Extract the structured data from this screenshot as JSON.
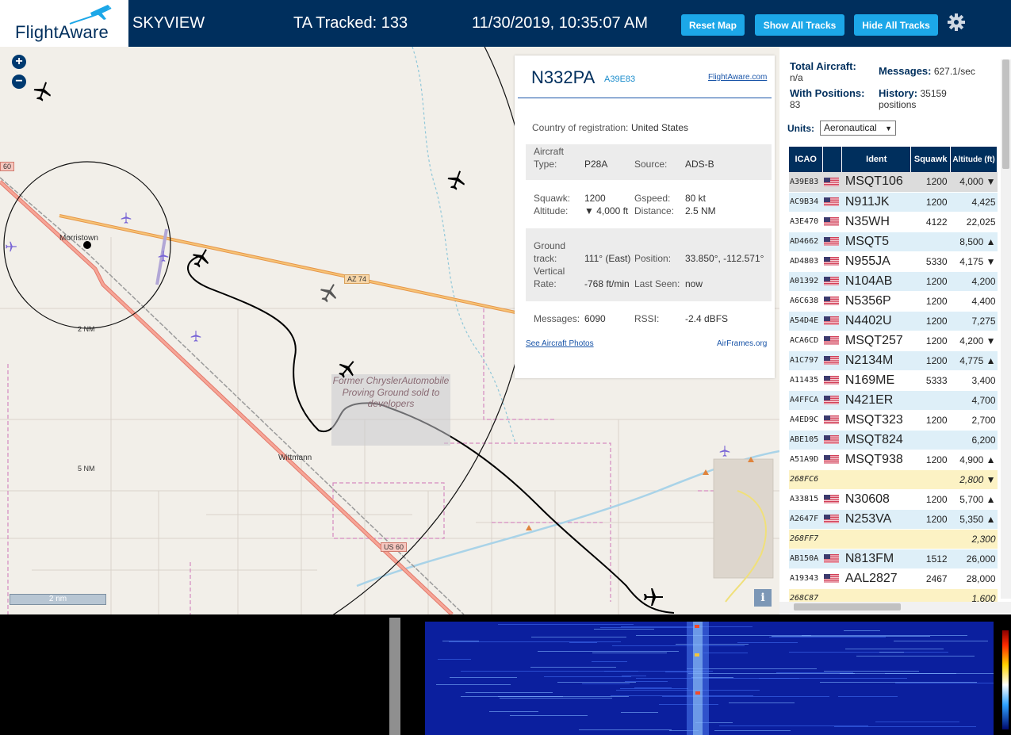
{
  "header": {
    "logo_text": "FlightAware",
    "app_name": "SKYVIEW",
    "tracked": "TA Tracked: 133",
    "datetime": "11/30/2019, 10:35:07 AM",
    "buttons": {
      "reset_map": "Reset Map",
      "show_all": "Show All Tracks",
      "hide_all": "Hide All Tracks"
    },
    "settings_icon": "gear-icon"
  },
  "map": {
    "labels": {
      "town1": "Morristown",
      "town2": "Wittmann",
      "ring1": "2 NM",
      "ring2": "5 NM",
      "road_az74": "AZ 74",
      "road_us60": "US 60",
      "road_60": "60",
      "proving_ground": "Former ChryslerAutomobile Proving Ground sold to developers"
    },
    "scalebar": "2 nm",
    "zoom_in": "+",
    "zoom_out": "−",
    "info_label": "i"
  },
  "popup": {
    "ident": "N332PA",
    "icao": "A39E83",
    "fa_link": "FlightAware.com",
    "country_label": "Country of registration:",
    "country": "United States",
    "aircraft_type_label_1": "Aircraft",
    "aircraft_type_label_2": "Type:",
    "aircraft_type": "P28A",
    "source_label": "Source:",
    "source": "ADS-B",
    "squawk_label": "Squawk:",
    "squawk": "1200",
    "gspeed_label": "Gspeed:",
    "gspeed": "80 kt",
    "altitude_label": "Altitude:",
    "altitude": "▼ 4,000 ft",
    "distance_label": "Distance:",
    "distance": "2.5 NM",
    "track_label_1": "Ground",
    "track_label_2": "track:",
    "track": "111° (East)",
    "position_label": "Position:",
    "position": "33.850°, -112.571°",
    "vrate_label_1": "Vertical",
    "vrate_label_2": "Rate:",
    "vrate": "-768 ft/min",
    "last_seen_label": "Last Seen:",
    "last_seen": "now",
    "messages_label": "Messages:",
    "messages": "6090",
    "rssi_label": "RSSI:",
    "rssi": "-2.4 dBFS",
    "photos_link": "See Aircraft Photos",
    "airframes_link": "AirFrames.org"
  },
  "sidebar": {
    "total_label": "Total Aircraft:",
    "total": "n/a",
    "messages_label": "Messages:",
    "messages": "627.1/sec",
    "with_pos_label": "With Positions:",
    "with_pos": "83",
    "history_label": "History:",
    "history": "35159 positions",
    "units_label": "Units:",
    "units_value": "Aeronautical",
    "columns": [
      "ICAO",
      "",
      "Ident",
      "Squawk",
      "Altitude (ft)"
    ],
    "rows": [
      {
        "icao": "A39E83",
        "flag": true,
        "ident": "MSQT106",
        "squawk": "1200",
        "alt": "4,000 ▼",
        "style": "selected"
      },
      {
        "icao": "AC9B34",
        "flag": true,
        "ident": "N911JK",
        "squawk": "1200",
        "alt": "4,425",
        "style": "even"
      },
      {
        "icao": "A3E470",
        "flag": true,
        "ident": "N35WH",
        "squawk": "4122",
        "alt": "22,025",
        "style": "odd"
      },
      {
        "icao": "AD4662",
        "flag": true,
        "ident": "MSQT5",
        "squawk": "",
        "alt": "8,500 ▲",
        "style": "even"
      },
      {
        "icao": "AD4803",
        "flag": true,
        "ident": "N955JA",
        "squawk": "5330",
        "alt": "4,175 ▼",
        "style": "odd"
      },
      {
        "icao": "A01392",
        "flag": true,
        "ident": "N104AB",
        "squawk": "1200",
        "alt": "4,200",
        "style": "even"
      },
      {
        "icao": "A6C638",
        "flag": true,
        "ident": "N5356P",
        "squawk": "1200",
        "alt": "4,400",
        "style": "odd"
      },
      {
        "icao": "A54D4E",
        "flag": true,
        "ident": "N4402U",
        "squawk": "1200",
        "alt": "7,275",
        "style": "even"
      },
      {
        "icao": "ACA6CD",
        "flag": true,
        "ident": "MSQT257",
        "squawk": "1200",
        "alt": "4,200 ▼",
        "style": "odd"
      },
      {
        "icao": "A1C797",
        "flag": true,
        "ident": "N2134M",
        "squawk": "1200",
        "alt": "4,775 ▲",
        "style": "even"
      },
      {
        "icao": "A11435",
        "flag": true,
        "ident": "N169ME",
        "squawk": "5333",
        "alt": "3,400",
        "style": "odd"
      },
      {
        "icao": "A4FFCA",
        "flag": true,
        "ident": "N421ER",
        "squawk": "",
        "alt": "4,700",
        "style": "even"
      },
      {
        "icao": "A4ED9C",
        "flag": true,
        "ident": "MSQT323",
        "squawk": "1200",
        "alt": "2,700",
        "style": "odd"
      },
      {
        "icao": "ABE105",
        "flag": true,
        "ident": "MSQT824",
        "squawk": "",
        "alt": "6,200",
        "style": "even"
      },
      {
        "icao": "A51A9D",
        "flag": true,
        "ident": "MSQT938",
        "squawk": "1200",
        "alt": "4,900 ▲",
        "style": "odd"
      },
      {
        "icao": "268FC6",
        "flag": false,
        "ident": "",
        "squawk": "",
        "alt": "2,800 ▼",
        "style": "nopos"
      },
      {
        "icao": "A33815",
        "flag": true,
        "ident": "N30608",
        "squawk": "1200",
        "alt": "5,700 ▲",
        "style": "odd"
      },
      {
        "icao": "A2647F",
        "flag": true,
        "ident": "N253VA",
        "squawk": "1200",
        "alt": "5,350 ▲",
        "style": "even"
      },
      {
        "icao": "268FF7",
        "flag": false,
        "ident": "",
        "squawk": "",
        "alt": "2,300",
        "style": "nopos"
      },
      {
        "icao": "AB150A",
        "flag": true,
        "ident": "N813FM",
        "squawk": "1512",
        "alt": "26,000",
        "style": "even"
      },
      {
        "icao": "A19343",
        "flag": true,
        "ident": "AAL2827",
        "squawk": "2467",
        "alt": "28,000",
        "style": "odd"
      },
      {
        "icao": "268C87",
        "flag": false,
        "ident": "",
        "squawk": "",
        "alt": "1,600",
        "style": "nopos"
      }
    ]
  },
  "colors": {
    "header_bg": "#002f5d",
    "button_bg": "#1ca7e8",
    "road_orange": "#f0a64b",
    "track_line": "#000000",
    "waterfall_bg": "#0b1f9e"
  }
}
